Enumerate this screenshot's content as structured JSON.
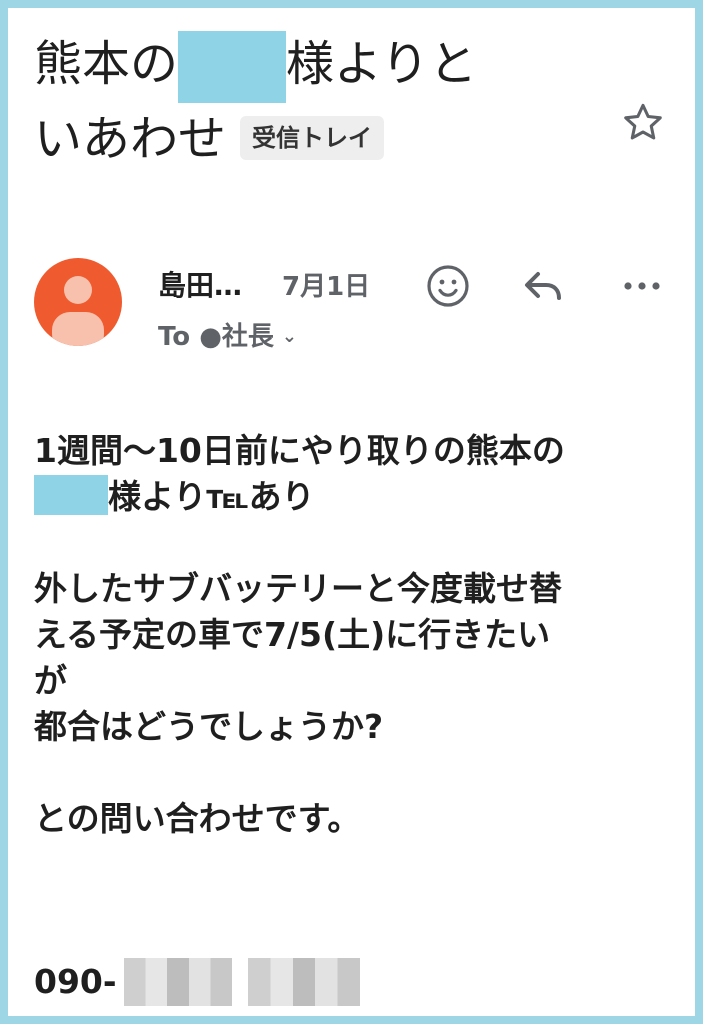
{
  "subject": {
    "line1_prefix": "熊本の",
    "line1_suffix": "様よりと",
    "line2": "いあわせ",
    "label": "受信トレイ"
  },
  "header": {
    "sender": "島田…",
    "date": "7月1日",
    "to_prefix": "To",
    "to_name": "●社長"
  },
  "icons": {
    "star": "star-outline-icon",
    "emoji": "smiley-icon",
    "reply": "reply-arrow-icon",
    "more": "more-horizontal-icon",
    "avatar": "person-icon"
  },
  "body": {
    "p1_line1": "1週間〜10日前にやり取りの熊本の",
    "p1_line2_suffix": "様より℡あり",
    "p2_line1": "外したサブバッテリーと今度載せ替",
    "p2_line2": "える予定の車で7/5(土)に行きたい",
    "p2_line3": "が",
    "p2_line4": "都合はどうでしょうか?",
    "p3": "との問い合わせです。",
    "phone_prefix": "090-"
  },
  "colors": {
    "avatar": "#ef5a2e",
    "redaction": "#8fd3e6",
    "frame": "#9fd6e6"
  }
}
